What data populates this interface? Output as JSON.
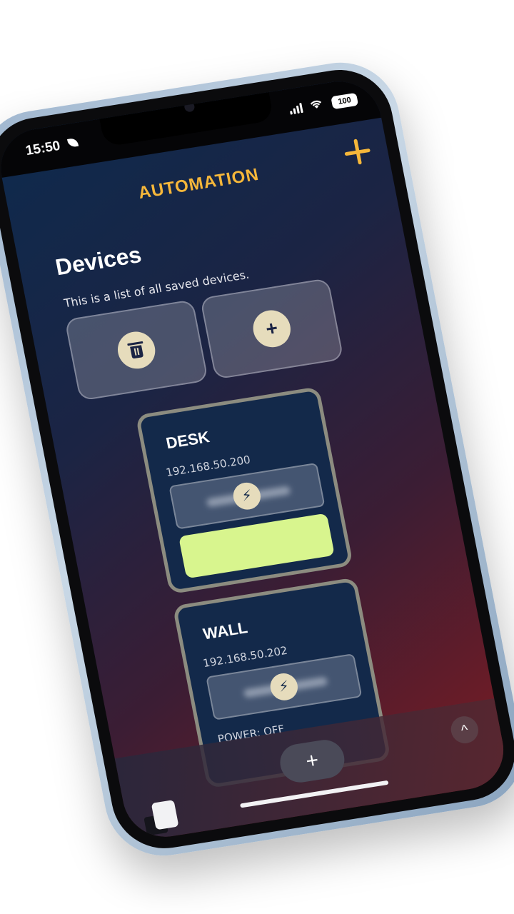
{
  "status_bar": {
    "time": "15:50",
    "battery": "100"
  },
  "header": {
    "title": "AUTOMATION",
    "add_icon": "plus-icon",
    "accent_color": "#f6b73a"
  },
  "page": {
    "heading": "Devices",
    "subtitle": "This is a list of all saved devices."
  },
  "actions": {
    "delete_icon": "trash-icon",
    "add_label": "+"
  },
  "devices": [
    {
      "name": "DESK",
      "ip": "192.168.50.200",
      "power_icon": "⚡",
      "toggle_color": "#d8f58e"
    },
    {
      "name": "WALL",
      "ip": "192.168.50.202",
      "power_icon": "⚡",
      "power_status": "POWER: OFF"
    }
  ],
  "bottom_nav": {
    "fab_label": "+",
    "scroll_up_label": "^"
  }
}
